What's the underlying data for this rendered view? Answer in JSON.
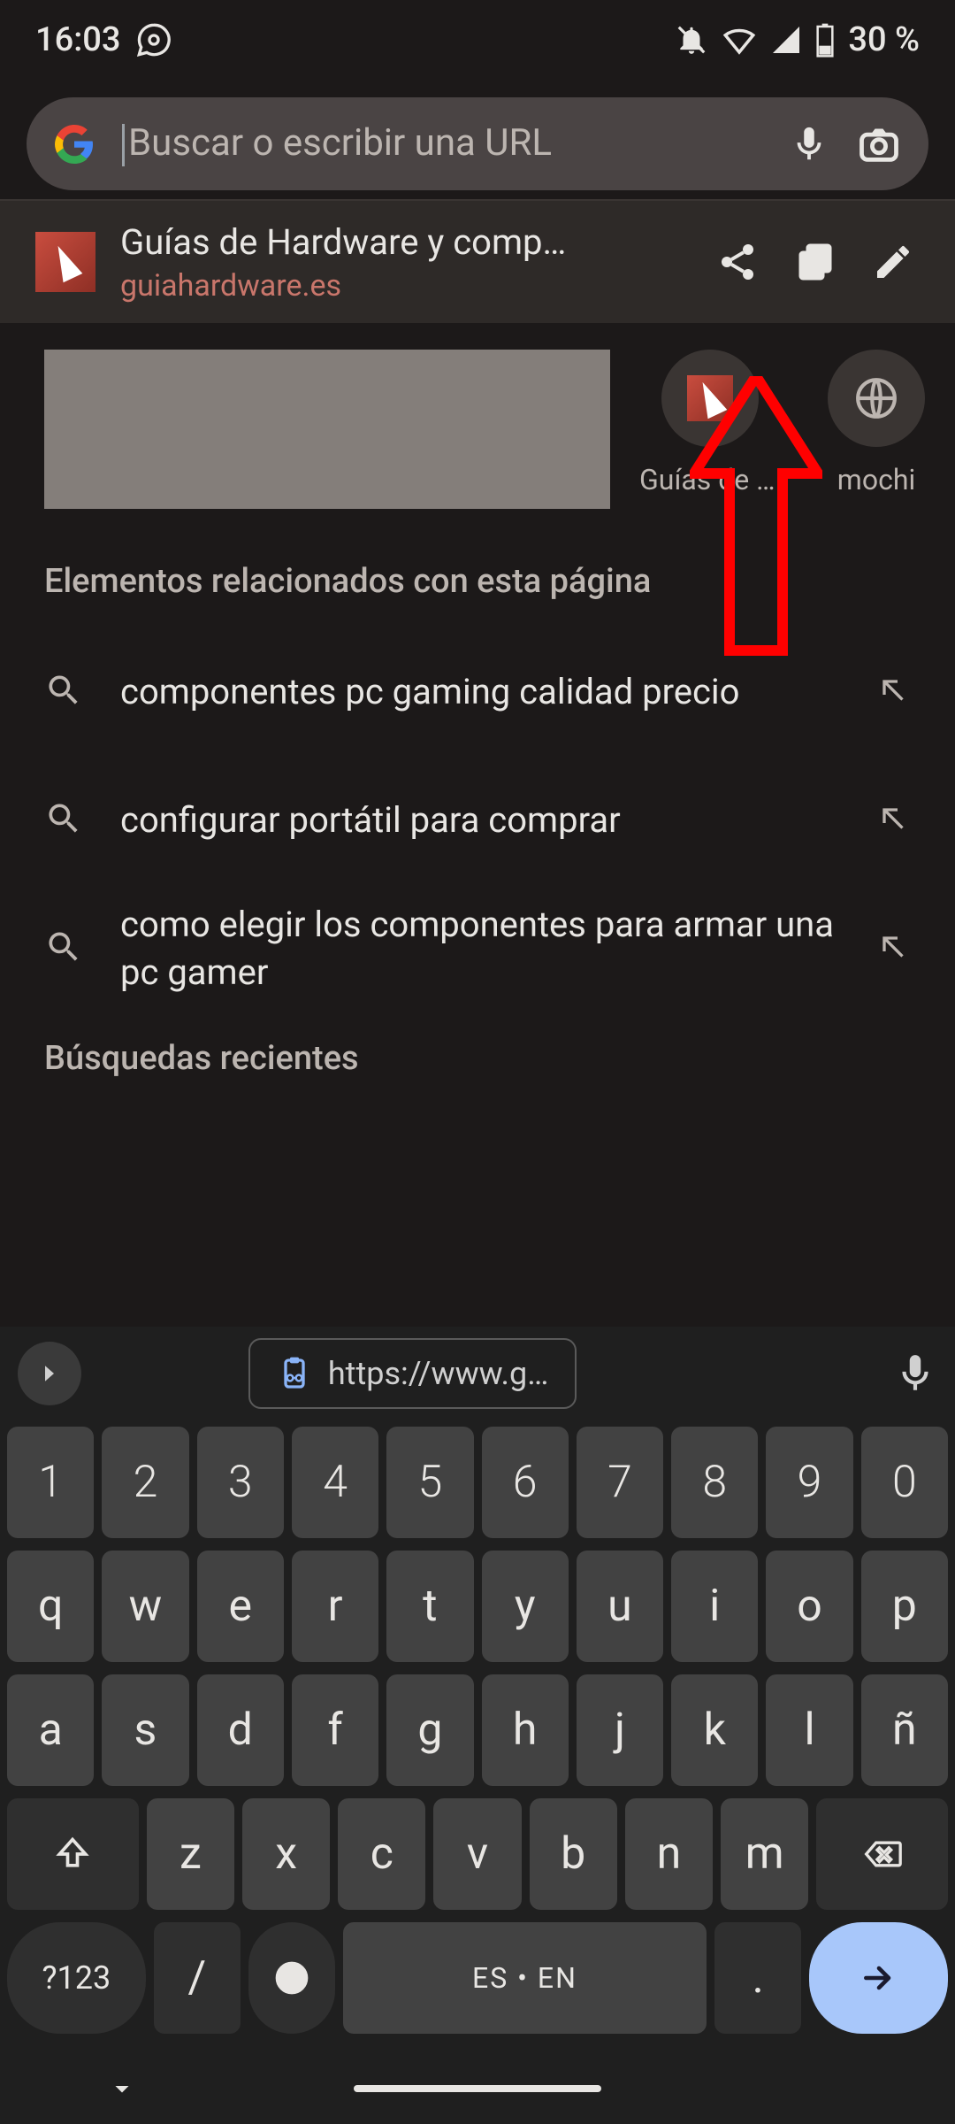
{
  "status": {
    "time": "16:03",
    "battery": "30 %"
  },
  "search": {
    "placeholder": "Buscar o escribir una URL"
  },
  "current_page": {
    "title": "Guías de Hardware y comp…",
    "url": "guiahardware.es"
  },
  "shortcuts": [
    {
      "label": "Guías de H…"
    },
    {
      "label": "mochi"
    }
  ],
  "sections": {
    "related": "Elementos relacionados con esta página",
    "recent": "Búsquedas recientes"
  },
  "suggestions": [
    {
      "text": "componentes pc gaming calidad precio"
    },
    {
      "text": "configurar portátil para comprar"
    },
    {
      "text": "como elegir los componentes para armar una pc gamer"
    }
  ],
  "keyboard": {
    "clipboard": "https://www.g…",
    "rows": {
      "num": [
        "1",
        "2",
        "3",
        "4",
        "5",
        "6",
        "7",
        "8",
        "9",
        "0"
      ],
      "r1": [
        "q",
        "w",
        "e",
        "r",
        "t",
        "y",
        "u",
        "i",
        "o",
        "p"
      ],
      "r2": [
        "a",
        "s",
        "d",
        "f",
        "g",
        "h",
        "j",
        "k",
        "l",
        "ñ"
      ],
      "r3": [
        "z",
        "x",
        "c",
        "v",
        "b",
        "n",
        "m"
      ]
    },
    "sym": "?123",
    "slash": "/",
    "space_label": "ES • EN",
    "dot": "."
  }
}
